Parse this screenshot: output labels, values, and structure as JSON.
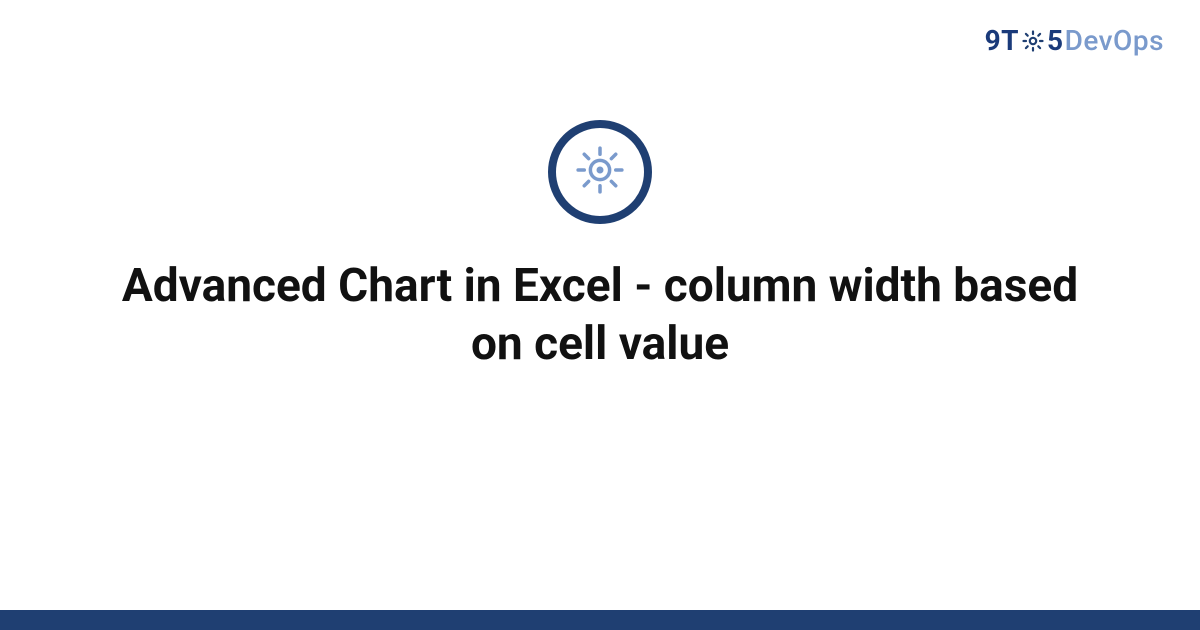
{
  "brand": {
    "prefix": "9T",
    "middle": "5",
    "suffix": "DevOps"
  },
  "title": "Advanced Chart in Excel - column width based on cell value",
  "colors": {
    "brand_dark": "#1f3f72",
    "brand_light": "#7a9acc",
    "footer": "#1f3f72",
    "text": "#111111"
  }
}
